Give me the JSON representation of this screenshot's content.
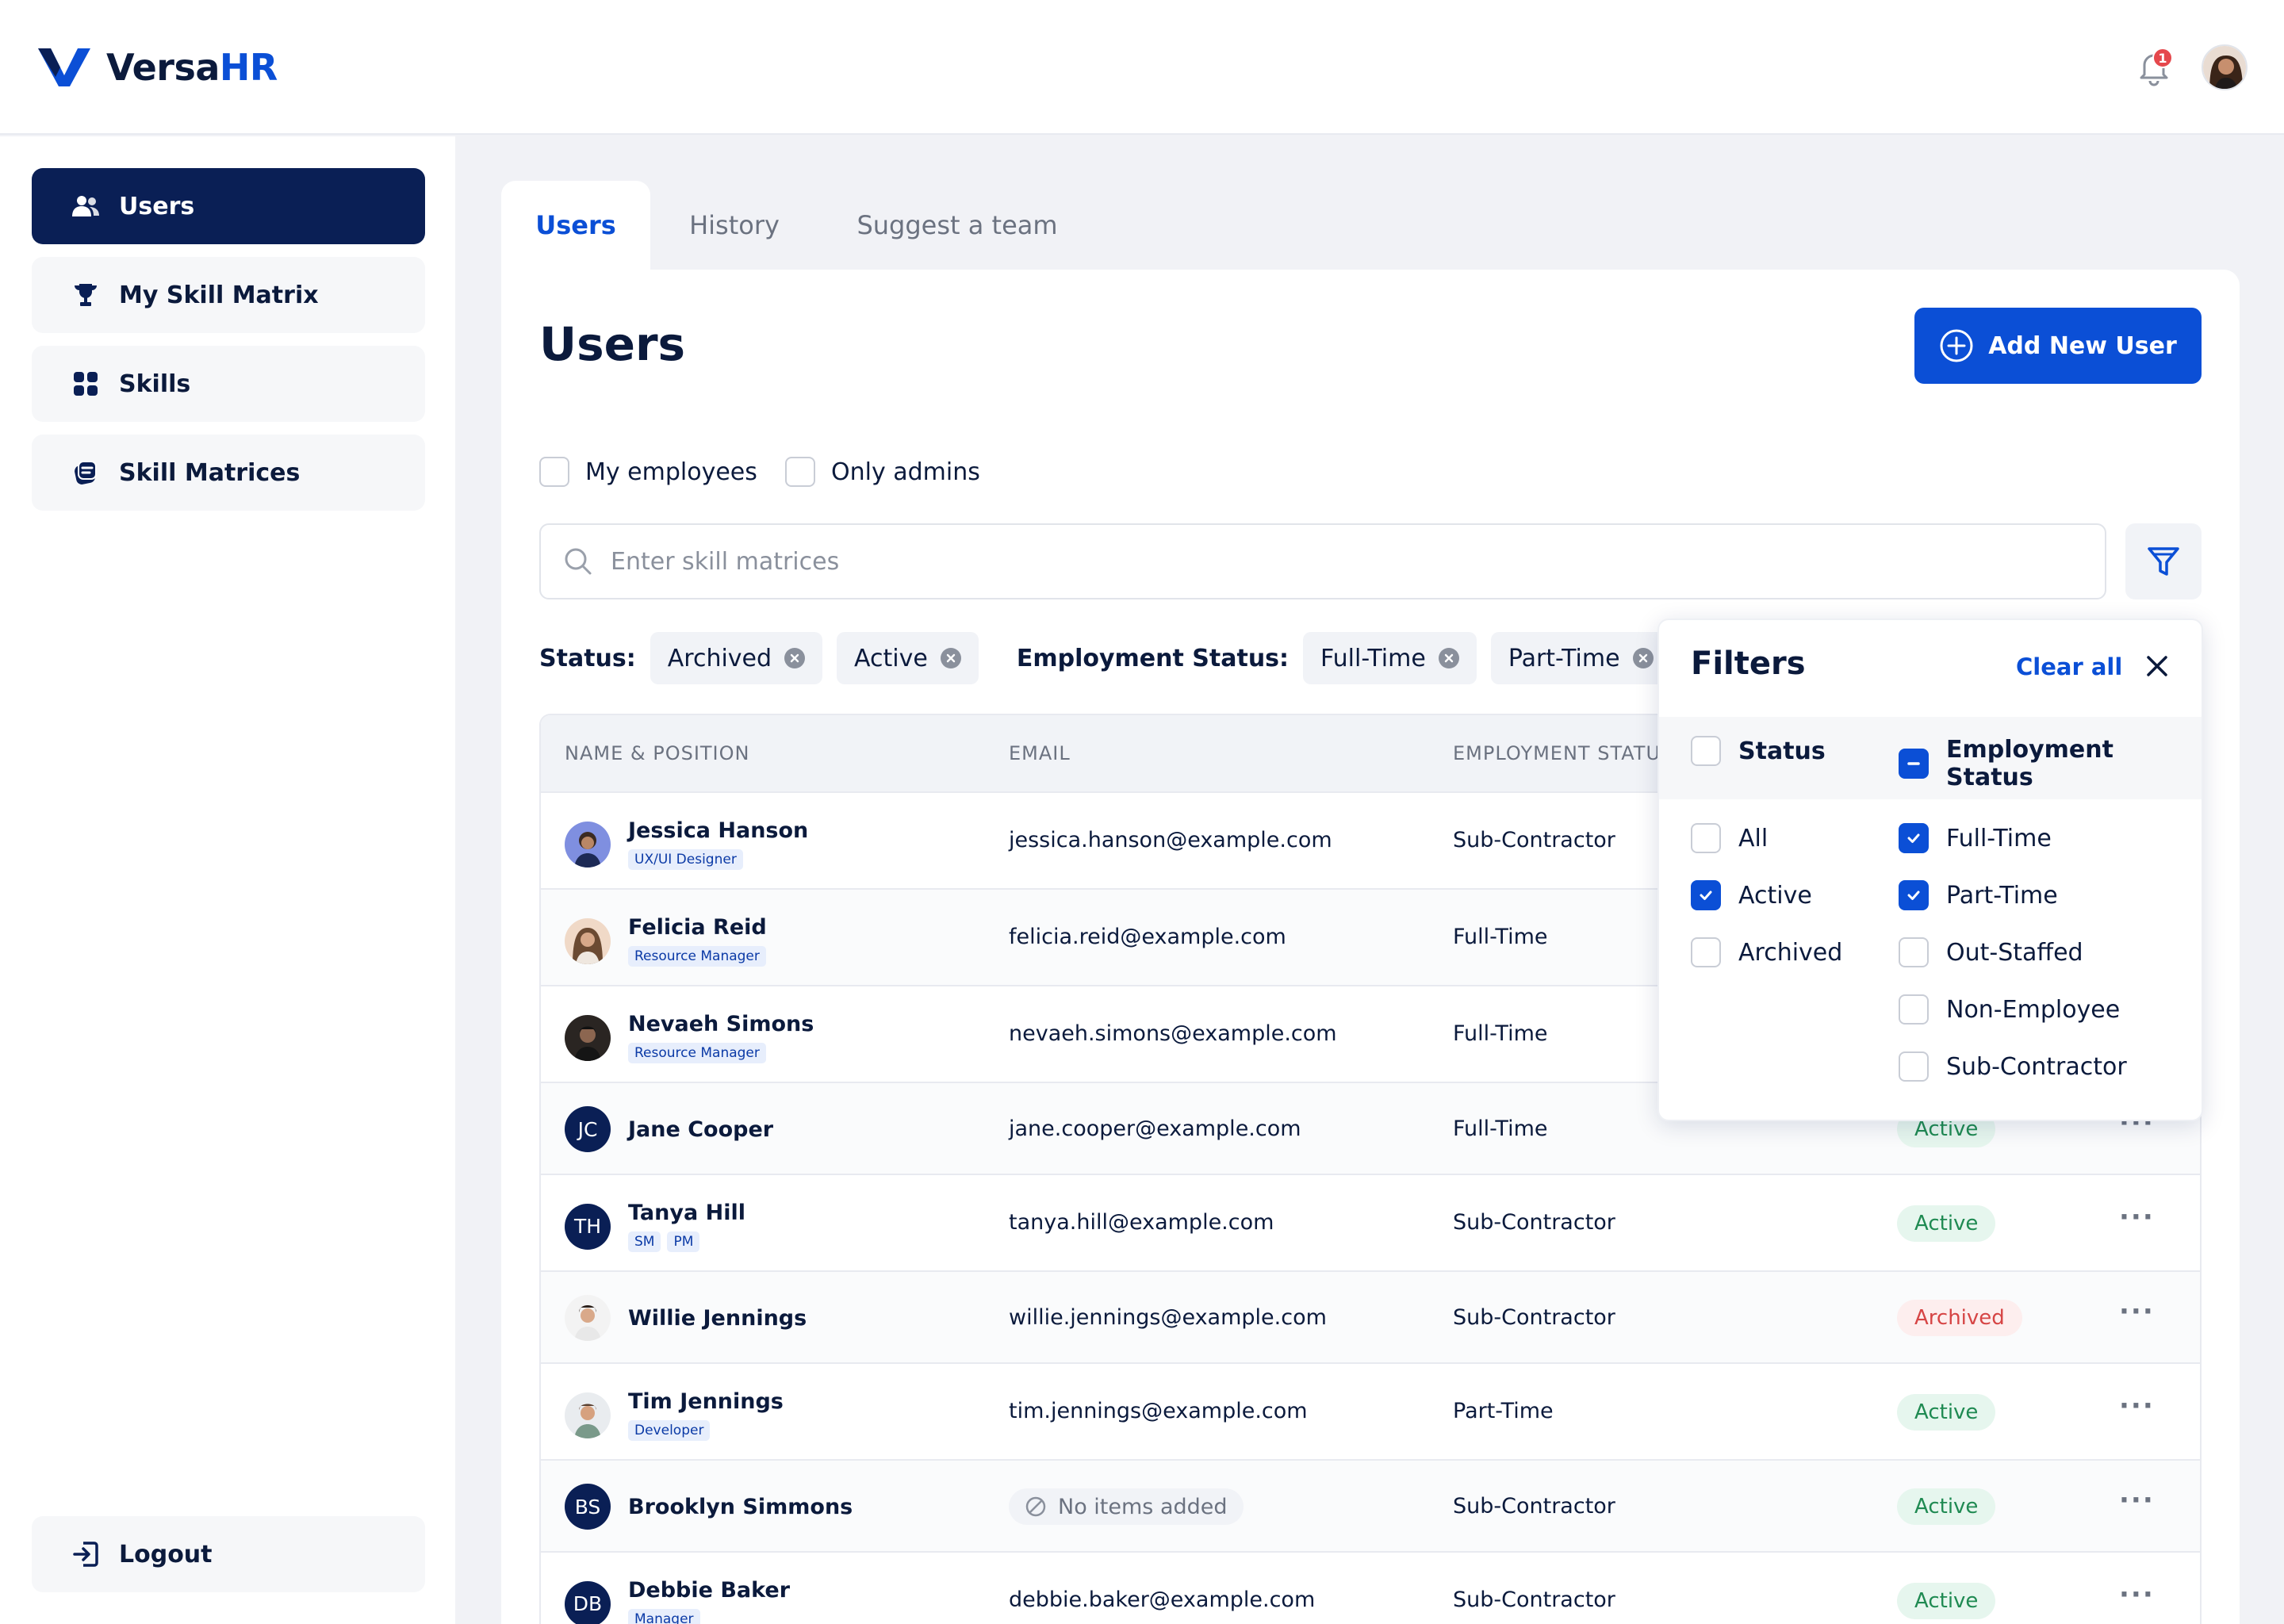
{
  "app": {
    "name_main": "Versa",
    "name_accent": "HR",
    "notification_count": "1"
  },
  "sidebar": {
    "items": [
      {
        "label": "Users",
        "icon": "users-icon",
        "active": true
      },
      {
        "label": "My Skill Matrix",
        "icon": "trophy-icon"
      },
      {
        "label": "Skills",
        "icon": "grid-icon"
      },
      {
        "label": "Skill Matrices",
        "icon": "stack-icon"
      }
    ],
    "logout": "Logout"
  },
  "tabs": [
    {
      "label": "Users"
    },
    {
      "label": "History"
    },
    {
      "label": "Suggest a team"
    }
  ],
  "page": {
    "title": "Users",
    "add_button": "Add New User"
  },
  "toggles": {
    "my_employees": "My employees",
    "only_admins": "Only admins"
  },
  "search": {
    "placeholder": "Enter skill matrices"
  },
  "active_filters": {
    "status_label": "Status:",
    "status": [
      "Archived",
      "Active"
    ],
    "employment_label": "Employment Status:",
    "employment": [
      "Full-Time",
      "Part-Time"
    ]
  },
  "table": {
    "headers": [
      "NAME & POSITION",
      "EMAIL",
      "EMPLOYMENT STATUS"
    ],
    "rows": [
      {
        "name": "Jessica Hanson",
        "tags": [
          "UX/UI Designer"
        ],
        "email": "jessica.hanson@example.com",
        "employment": "Sub-Contractor",
        "status": "",
        "avatar": "photo"
      },
      {
        "name": "Felicia Reid",
        "tags": [
          "Resource Manager"
        ],
        "email": "felicia.reid@example.com",
        "employment": "Full-Time",
        "status": "",
        "avatar": "photo"
      },
      {
        "name": "Nevaeh Simons",
        "tags": [
          "Resource Manager"
        ],
        "email": "nevaeh.simons@example.com",
        "employment": "Full-Time",
        "status": "",
        "avatar": "photo"
      },
      {
        "name": "Jane Cooper",
        "tags": [],
        "email": "jane.cooper@example.com",
        "employment": "Full-Time",
        "status": "Active",
        "initials": "JC"
      },
      {
        "name": "Tanya Hill",
        "tags": [
          "SM",
          "PM"
        ],
        "email": "tanya.hill@example.com",
        "employment": "Sub-Contractor",
        "status": "Active",
        "initials": "TH"
      },
      {
        "name": "Willie Jennings",
        "tags": [],
        "email": "willie.jennings@example.com",
        "employment": "Sub-Contractor",
        "status": "Archived",
        "avatar": "photo"
      },
      {
        "name": "Tim Jennings",
        "tags": [
          "Developer"
        ],
        "email": "tim.jennings@example.com",
        "employment": "Part-Time",
        "status": "Active",
        "avatar": "photo"
      },
      {
        "name": "Brooklyn Simmons",
        "tags": [],
        "email": "No items added",
        "employment": "Sub-Contractor",
        "status": "Active",
        "initials": "BS"
      },
      {
        "name": "Debbie Baker",
        "tags": [
          "Manager"
        ],
        "email": "debbie.baker@example.com",
        "employment": "Sub-Contractor",
        "status": "Active",
        "initials": "DB"
      }
    ]
  },
  "filters": {
    "title": "Filters",
    "clear": "Clear all",
    "status_head": "Status",
    "employment_head": "Employment Status",
    "status_options": [
      {
        "label": "All",
        "checked": false
      },
      {
        "label": "Active",
        "checked": true
      },
      {
        "label": "Archived",
        "checked": false
      }
    ],
    "employment_options": [
      {
        "label": "Full-Time",
        "checked": true
      },
      {
        "label": "Part-Time",
        "checked": true
      },
      {
        "label": "Out-Staffed",
        "checked": false
      },
      {
        "label": "Non-Employee",
        "checked": false
      },
      {
        "label": "Sub-Contractor",
        "checked": false
      }
    ]
  },
  "colors": {
    "brand": "#0b4fd6",
    "navy": "#0a1f55",
    "active_green": "#1f8a52",
    "archived_red": "#d64545"
  }
}
